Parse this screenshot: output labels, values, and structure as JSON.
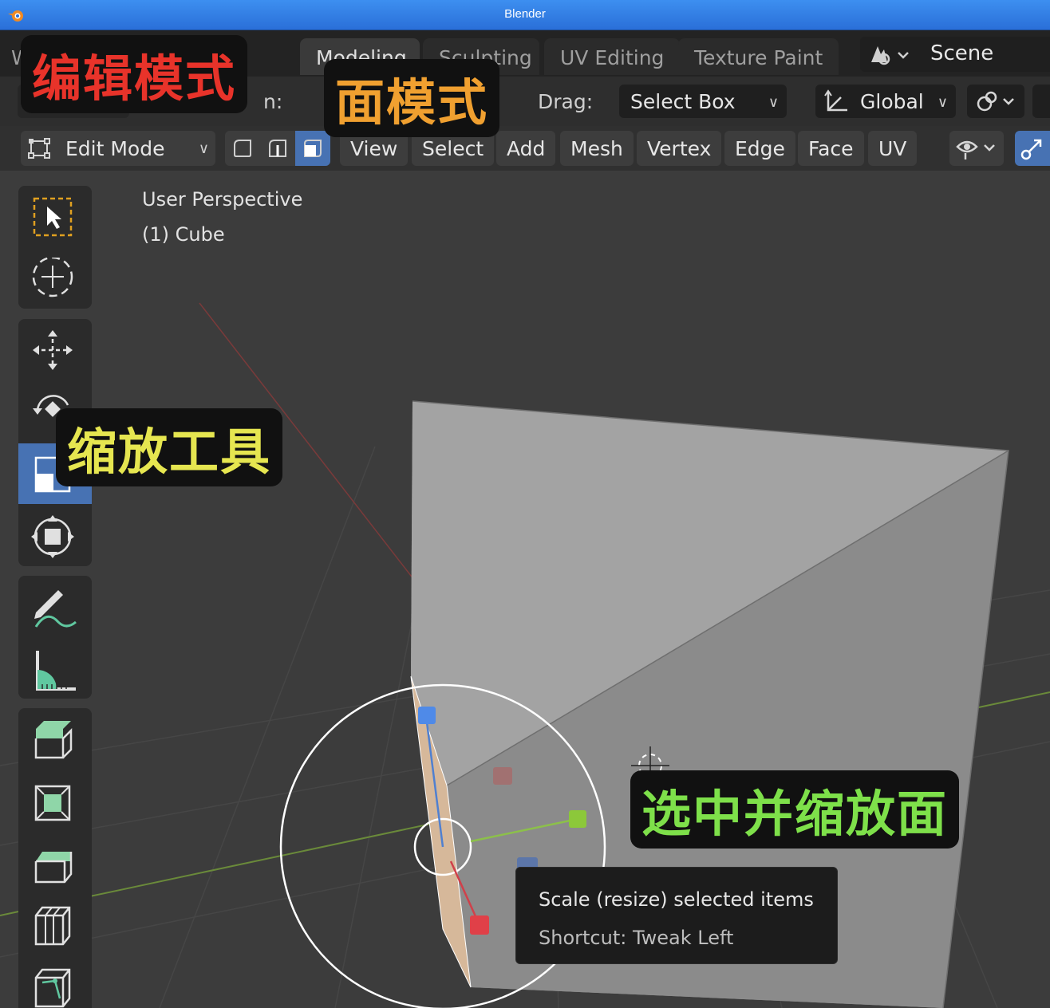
{
  "window": {
    "title": "Blender"
  },
  "tabs": [
    {
      "label": "W",
      "active": false
    },
    {
      "label": "Modeling",
      "active": true
    },
    {
      "label": "Sculpting",
      "active": false
    },
    {
      "label": "UV Editing",
      "active": false
    },
    {
      "label": "Texture Paint",
      "active": false
    }
  ],
  "scene": {
    "label": "Scene"
  },
  "tool_settings": {
    "fragment_label": "n:",
    "drag_label": "Drag:",
    "drag_value": "Select Box",
    "orientation_value": "Global"
  },
  "view_header": {
    "mode": "Edit Mode",
    "select_modes": [
      "vertex",
      "edge",
      "face"
    ],
    "active_select_mode": "face",
    "menus": [
      "View",
      "Select",
      "Add",
      "Mesh",
      "Vertex",
      "Edge",
      "Face",
      "UV"
    ]
  },
  "viewport": {
    "perspective": "User Perspective",
    "object": "(1) Cube"
  },
  "tooltip": {
    "line1": "Scale (resize) selected items",
    "line2": "Shortcut: Tweak Left"
  },
  "annotations": {
    "edit_mode": "编辑模式",
    "face_mode": "面模式",
    "scale_tool": "缩放工具",
    "select_scale_face": "选中并缩放面"
  },
  "colors": {
    "accent": "#4772b3",
    "annotation_red": "#e8332a",
    "annotation_orange": "#f0a030",
    "annotation_yellow": "#e6e650",
    "annotation_green": "#7ee04a"
  }
}
